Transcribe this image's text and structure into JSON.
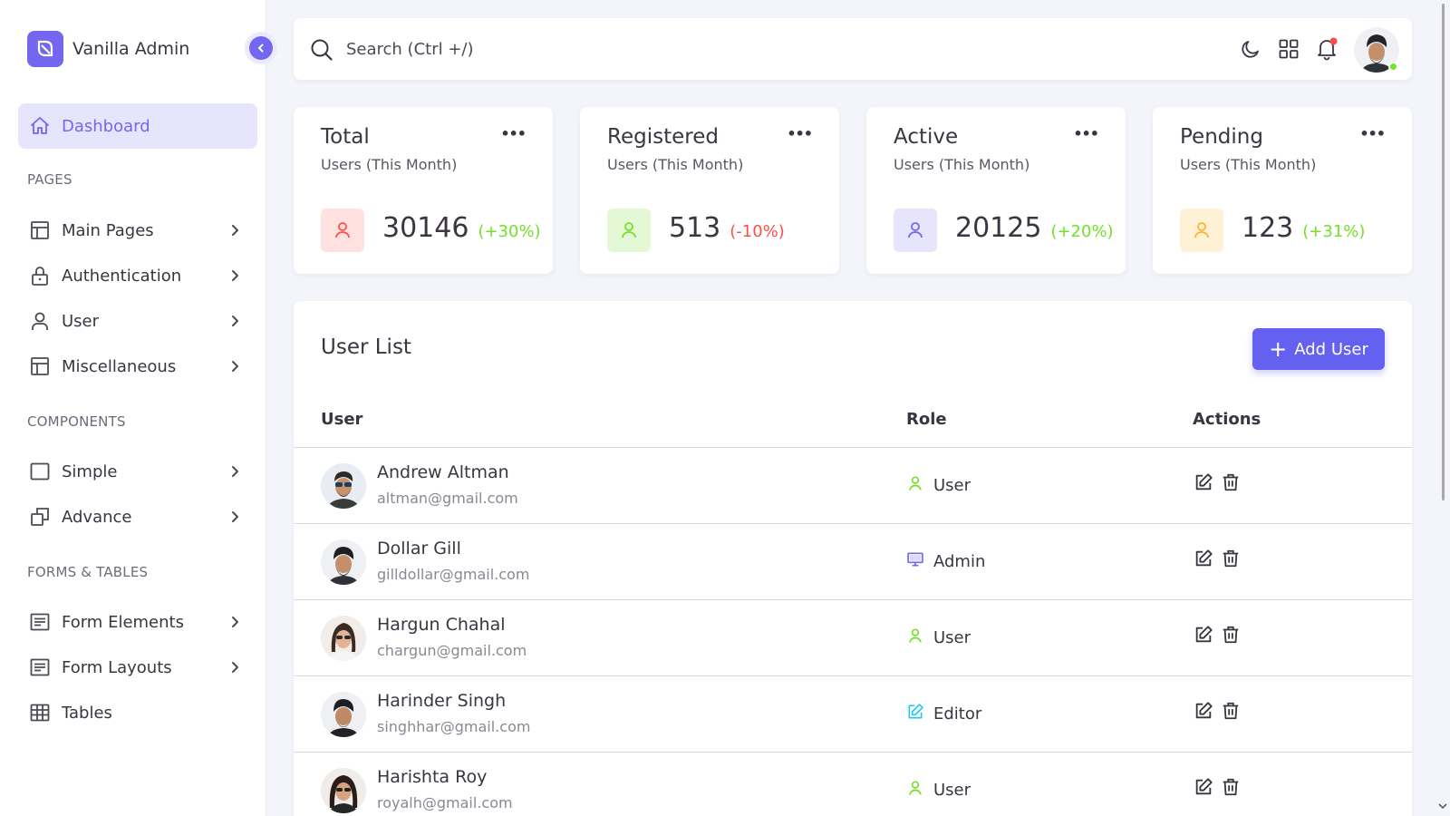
{
  "app": {
    "brand_name": "Vanilla Admin"
  },
  "sidebar": {
    "active_item": "Dashboard",
    "sections": [
      "PAGES",
      "COMPONENTS",
      "FORMS & TABLES"
    ],
    "items": [
      {
        "label": "Main Pages",
        "icon": "layout-icon"
      },
      {
        "label": "Authentication",
        "icon": "lock-icon"
      },
      {
        "label": "User",
        "icon": "user-icon"
      },
      {
        "label": "Miscellaneous",
        "icon": "layout-icon"
      },
      {
        "label": "Simple",
        "icon": "square-icon"
      },
      {
        "label": "Advance",
        "icon": "copy-icon"
      },
      {
        "label": "Form Elements",
        "icon": "form-icon"
      },
      {
        "label": "Form Layouts",
        "icon": "form-icon"
      },
      {
        "label": "Tables",
        "icon": "table-icon"
      }
    ]
  },
  "topbar": {
    "search_placeholder": "Search (Ctrl +/)"
  },
  "stats": [
    {
      "title": "Total",
      "subtitle": "Users (This Month)",
      "value": "30146",
      "change": "(+30%)",
      "accent": "#ff4d49",
      "change_color": "#72e128"
    },
    {
      "title": "Registered",
      "subtitle": "Users (This Month)",
      "value": "513",
      "change": "(-10%)",
      "accent": "#72e128",
      "change_color": "#ff4d49"
    },
    {
      "title": "Active",
      "subtitle": "Users (This Month)",
      "value": "20125",
      "change": "(+20%)",
      "accent": "#7367f0",
      "change_color": "#72e128"
    },
    {
      "title": "Pending",
      "subtitle": "Users (This Month)",
      "value": "123",
      "change": "(+31%)",
      "accent": "#fdb528",
      "change_color": "#72e128"
    }
  ],
  "user_list": {
    "title": "User List",
    "add_button": "Add User",
    "columns": [
      "User",
      "Role",
      "Actions"
    ],
    "rows": [
      {
        "name": "Andrew Altman",
        "email": "altman@gmail.com",
        "role": "User"
      },
      {
        "name": "Dollar Gill",
        "email": "gilldollar@gmail.com",
        "role": "Admin"
      },
      {
        "name": "Hargun Chahal",
        "email": "chargun@gmail.com",
        "role": "User"
      },
      {
        "name": "Harinder Singh",
        "email": "singhhar@gmail.com",
        "role": "Editor"
      },
      {
        "name": "Harishta Roy",
        "email": "royalh@gmail.com",
        "role": "User"
      }
    ]
  },
  "colors": {
    "primary": "#7367f0",
    "button": "#6460f0",
    "success": "#72e128",
    "error": "#ff4d49",
    "warning": "#fdb528",
    "editor": "#26c6f9"
  }
}
